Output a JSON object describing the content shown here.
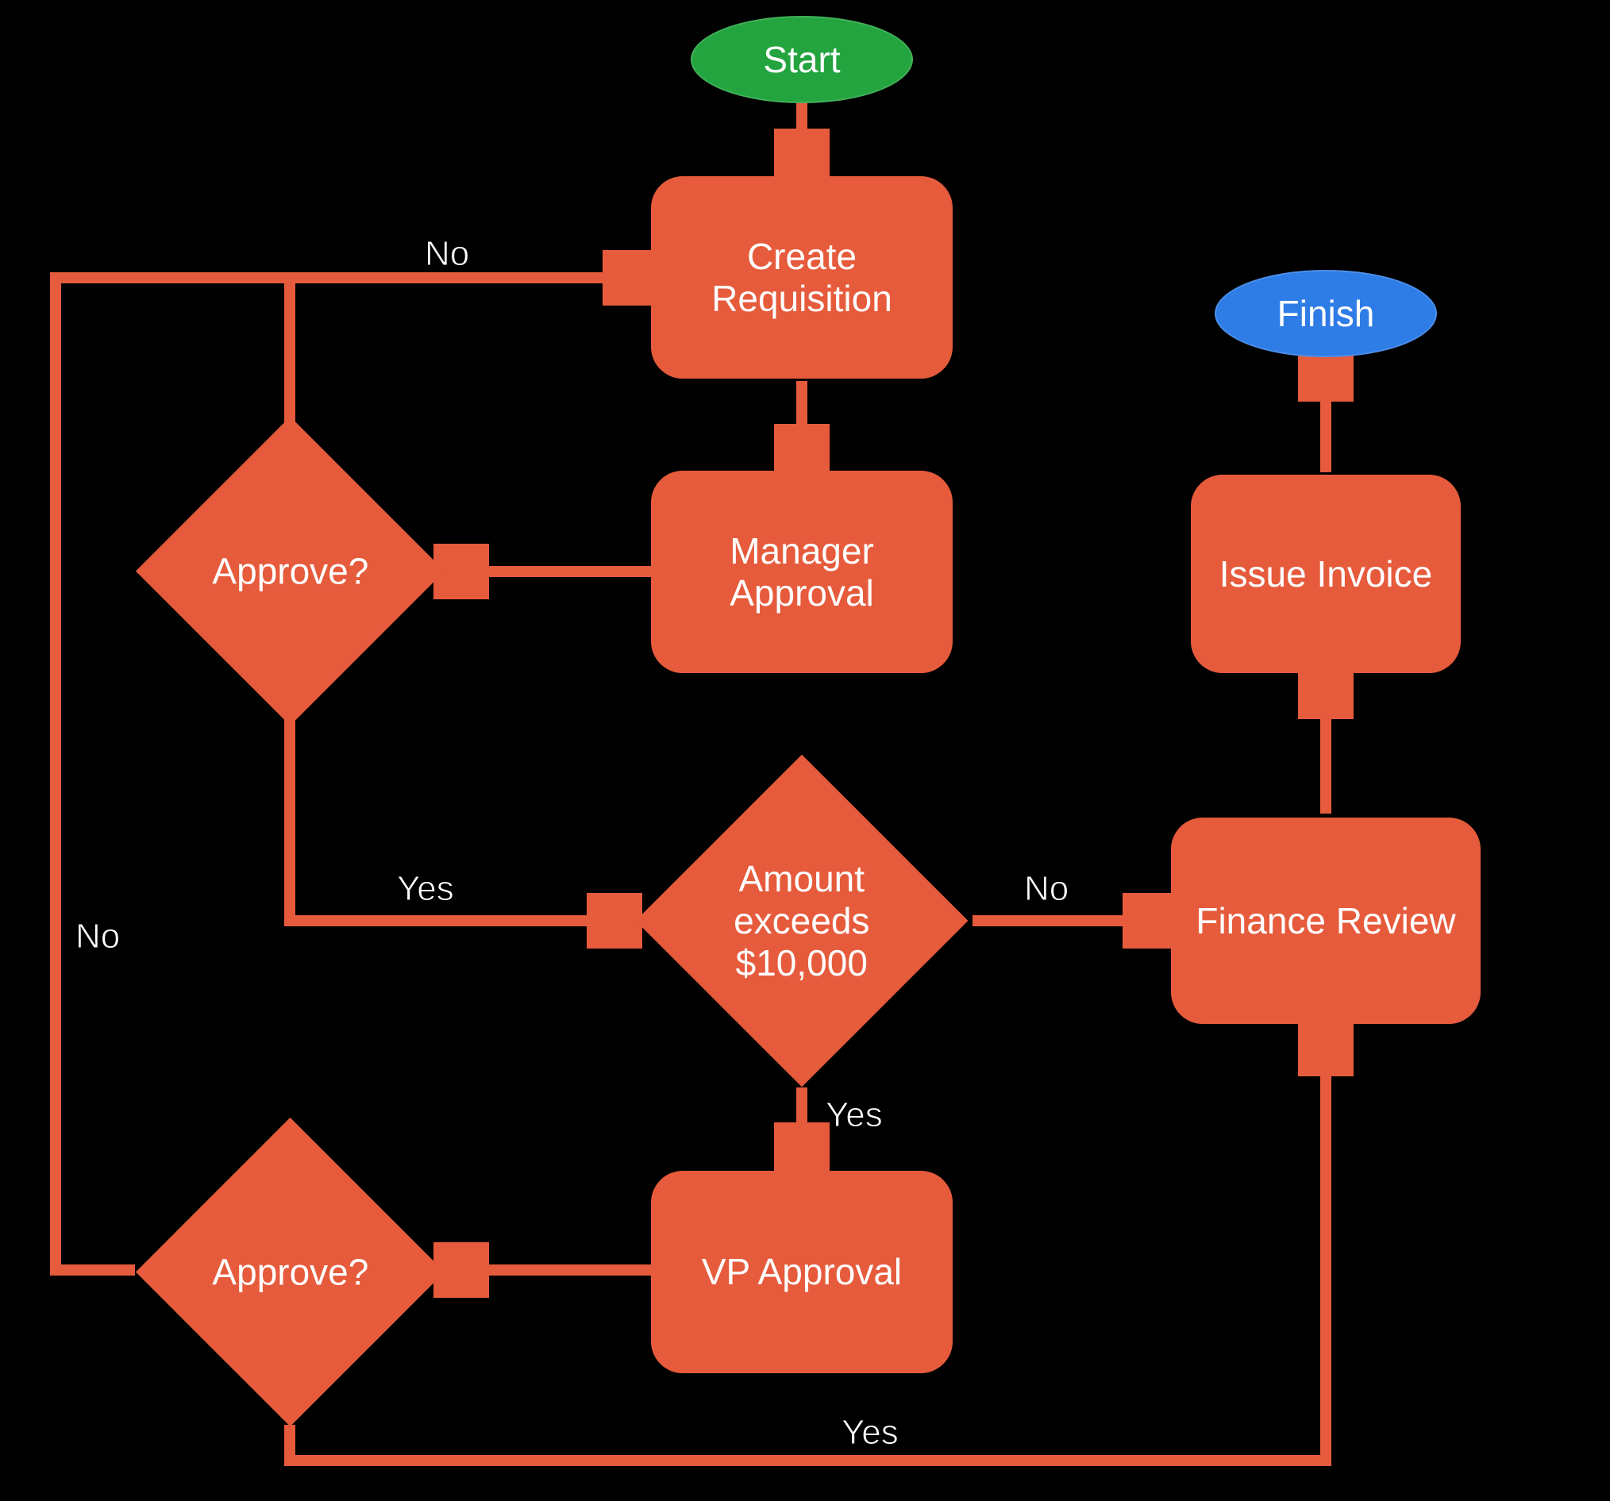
{
  "colors": {
    "process": "#e65b3c",
    "start": "#23a43f",
    "finish": "#2e7ce5",
    "background": "#000000",
    "text": "#ffffff"
  },
  "nodes": {
    "start": {
      "label": "Start",
      "type": "terminator"
    },
    "createReq": {
      "label": "Create Requisition",
      "type": "process"
    },
    "managerApproval": {
      "label": "Manager Approval",
      "type": "process"
    },
    "approve1": {
      "label": "Approve?",
      "type": "decision"
    },
    "amountExceeds": {
      "label": "Amount exceeds $10,000",
      "type": "decision"
    },
    "vpApproval": {
      "label": "VP Approval",
      "type": "process"
    },
    "approve2": {
      "label": "Approve?",
      "type": "decision"
    },
    "financeReview": {
      "label": "Finance Review",
      "type": "process"
    },
    "issueInvoice": {
      "label": "Issue Invoice",
      "type": "process"
    },
    "finish": {
      "label": "Finish",
      "type": "terminator"
    }
  },
  "edges": [
    {
      "from": "start",
      "to": "createReq",
      "label": ""
    },
    {
      "from": "createReq",
      "to": "managerApproval",
      "label": ""
    },
    {
      "from": "managerApproval",
      "to": "approve1",
      "label": ""
    },
    {
      "from": "approve1",
      "to": "createReq",
      "label": "No"
    },
    {
      "from": "approve1",
      "to": "amountExceeds",
      "label": "Yes"
    },
    {
      "from": "amountExceeds",
      "to": "financeReview",
      "label": "No"
    },
    {
      "from": "amountExceeds",
      "to": "vpApproval",
      "label": "Yes"
    },
    {
      "from": "vpApproval",
      "to": "approve2",
      "label": ""
    },
    {
      "from": "approve2",
      "to": "createReq",
      "label": "No"
    },
    {
      "from": "approve2",
      "to": "financeReview",
      "label": "Yes"
    },
    {
      "from": "financeReview",
      "to": "issueInvoice",
      "label": ""
    },
    {
      "from": "issueInvoice",
      "to": "finish",
      "label": ""
    }
  ],
  "edgeLabels": {
    "approve1_no": "No",
    "approve1_yes": "Yes",
    "amount_no": "No",
    "amount_yes": "Yes",
    "approve2_no": "No",
    "approve2_yes": "Yes"
  }
}
